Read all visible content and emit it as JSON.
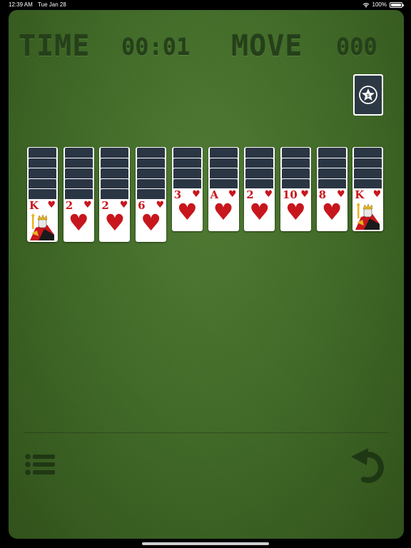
{
  "status_bar": {
    "time": "12:39 AM",
    "date": "Tue Jan 28",
    "battery": "100%"
  },
  "hud": {
    "time_label": "TIME",
    "time_value": "00:01",
    "move_label": "MOVE",
    "move_value": "000"
  },
  "stock": {
    "icon": "star-emblem-icon"
  },
  "piles": [
    {
      "face_down": 5,
      "top": {
        "rank": "K",
        "suit": "♥",
        "kind": "king"
      }
    },
    {
      "face_down": 5,
      "top": {
        "rank": "2",
        "suit": "♥",
        "kind": "pip"
      }
    },
    {
      "face_down": 5,
      "top": {
        "rank": "2",
        "suit": "♥",
        "kind": "pip"
      }
    },
    {
      "face_down": 5,
      "top": {
        "rank": "6",
        "suit": "♥",
        "kind": "pip"
      }
    },
    {
      "face_down": 4,
      "top": {
        "rank": "3",
        "suit": "♥",
        "kind": "pip"
      }
    },
    {
      "face_down": 4,
      "top": {
        "rank": "A",
        "suit": "♥",
        "kind": "pip"
      }
    },
    {
      "face_down": 4,
      "top": {
        "rank": "2",
        "suit": "♥",
        "kind": "pip"
      }
    },
    {
      "face_down": 4,
      "top": {
        "rank": "10",
        "suit": "♥",
        "kind": "pip"
      }
    },
    {
      "face_down": 4,
      "top": {
        "rank": "8",
        "suit": "♥",
        "kind": "pip"
      }
    },
    {
      "face_down": 4,
      "top": {
        "rank": "K",
        "suit": "♥",
        "kind": "king"
      }
    }
  ],
  "toolbar": {
    "menu_icon": "menu-list-icon",
    "undo_icon": "undo-icon"
  },
  "colors": {
    "felt": "#416b27",
    "engraved_text": "#25401a",
    "card_back": "#2b3644",
    "heart_red": "#c8161d"
  }
}
